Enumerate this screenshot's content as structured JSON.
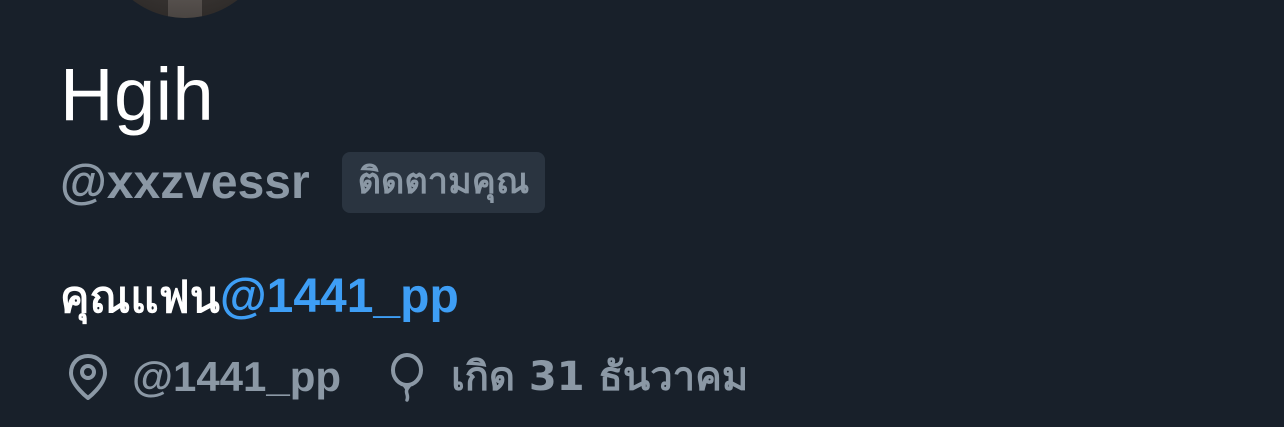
{
  "profile": {
    "display_name": "Hgih",
    "handle": "@xxzvessr",
    "follows_you_badge": "ติดตามคุณ",
    "bio": {
      "text": "คุณแฟน",
      "mention": "@1441_pp"
    },
    "location": "@1441_pp",
    "birthday": "เกิด 31 ธันวาคม",
    "icons": {
      "location": "location-pin-icon",
      "birthday": "balloon-icon"
    },
    "colors": {
      "background": "#18202a",
      "primary_text": "#ffffff",
      "secondary_text": "#8b98a5",
      "link": "#3e9ef5",
      "badge_bg": "#2a3440"
    }
  }
}
